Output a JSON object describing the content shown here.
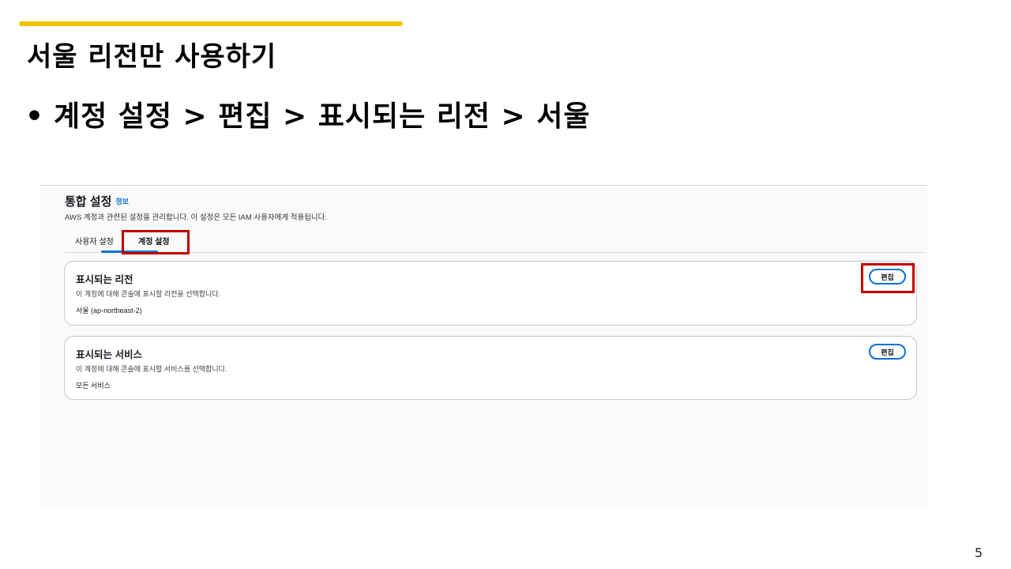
{
  "colors": {
    "accent_bar": "#f2c200",
    "highlight_box": "#c00000",
    "link_blue": "#0972d3"
  },
  "slide": {
    "title": "서울 리전만 사용하기",
    "bullet_symbol": "•",
    "bullet_text": "계정 설정 > 편집 > 표시되는 리전 > 서울",
    "page_number": "5"
  },
  "console": {
    "title": "통합 설정",
    "info_link": "정보",
    "description": "AWS 계정과 관련된 설정을 관리합니다. 이 설정은 모든 IAM 사용자에게 적용됩니다.",
    "tabs": [
      {
        "label": "사용자 설정",
        "selected": false
      },
      {
        "label": "계정 설정",
        "selected": true
      }
    ],
    "cards": [
      {
        "title": "표시되는 리전",
        "description": "이 계정에 대해 콘솔에 표시할 리전을 선택합니다.",
        "value": "서울 (ap-northeast-2)",
        "button_label": "편집"
      },
      {
        "title": "표시되는 서비스",
        "description": "이 계정에 대해 콘솔에 표시할 서비스를 선택합니다.",
        "value": "모든 서비스",
        "button_label": "편집"
      }
    ]
  }
}
